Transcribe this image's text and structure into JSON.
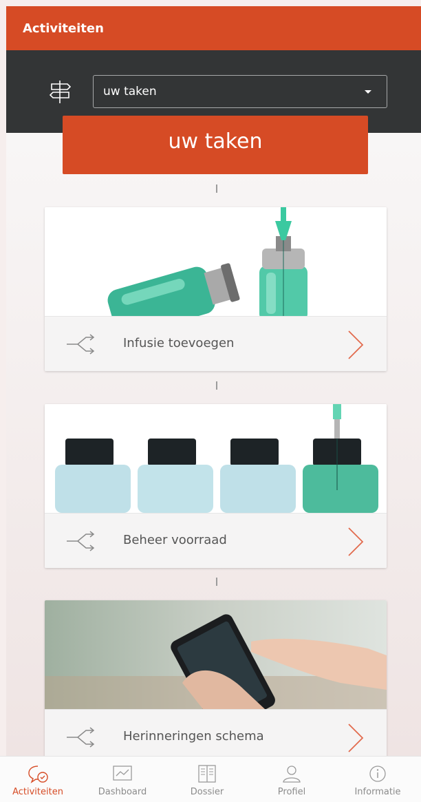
{
  "header": {
    "title": "Activiteiten"
  },
  "filter": {
    "selected": "uw taken"
  },
  "banner": {
    "title": "uw taken"
  },
  "cards": [
    {
      "label": "Infusie toevoegen"
    },
    {
      "label": "Beheer voorraad"
    },
    {
      "label": "Herinneringen schema"
    }
  ],
  "tabs": [
    {
      "label": "Activiteiten"
    },
    {
      "label": "Dashboard"
    },
    {
      "label": "Dossier"
    },
    {
      "label": "Profiel"
    },
    {
      "label": "Informatie"
    }
  ],
  "colors": {
    "accent": "#d64b25",
    "bar": "#333536",
    "teal": "#3bc9a0"
  }
}
